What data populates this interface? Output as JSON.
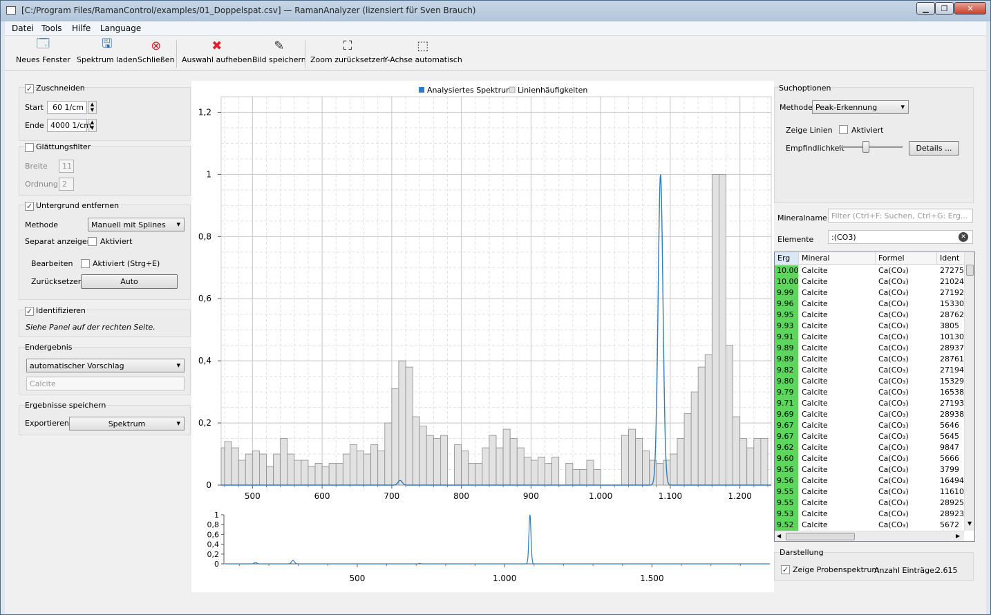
{
  "title": "[C:/Program Files/RamanControl/examples/01_Doppelspat.csv] — RamanAnalyzer (lizensiert für Sven Brauch)",
  "menu": [
    "Datei",
    "Tools",
    "Hilfe",
    "Language"
  ],
  "toolbar": [
    {
      "label": "Neues Fenster",
      "icon": "window-icon"
    },
    {
      "label": "Spektrum laden",
      "icon": "load-icon"
    },
    {
      "label": "Schließen",
      "icon": "close-doc-icon"
    },
    {
      "label": "Auswahl aufheben",
      "icon": "deselect-icon"
    },
    {
      "label": "Bild speichern",
      "icon": "save-image-icon"
    },
    {
      "label": "Zoom zurücksetzen",
      "icon": "zoom-reset-icon"
    },
    {
      "label": "Y-Achse automatisch",
      "icon": "y-auto-icon"
    }
  ],
  "left": {
    "crop": {
      "label": "Zuschneiden",
      "checked": true,
      "start_label": "Start",
      "start": "60 1/cm",
      "end_label": "Ende",
      "end": "4000 1/cm"
    },
    "smooth": {
      "label": "Glättungsfilter",
      "checked": false,
      "width_label": "Breite",
      "width": "11",
      "order_label": "Ordnung",
      "order": "2"
    },
    "background": {
      "label": "Untergrund entfernen",
      "checked": true,
      "method_label": "Methode",
      "method": "Manuell mit Splines",
      "separate_label": "Separat anzeigen",
      "separate_cb": "Aktiviert",
      "edit_label": "Bearbeiten",
      "edit_cb": "Aktiviert (Strg+E)",
      "reset_label": "Zurücksetzen",
      "reset_btn": "Auto"
    },
    "identify": {
      "label": "Identifizieren",
      "checked": true,
      "hint": "Siehe Panel auf der rechten Seite."
    },
    "result": {
      "label": "Endergebnis",
      "combo": "automatischer Vorschlag",
      "value": "Calcite"
    },
    "save": {
      "label": "Ergebnisse speichern",
      "export_label": "Exportieren",
      "export_combo": "Spektrum"
    }
  },
  "chart_data": [
    {
      "type": "area",
      "legend": [
        "Analysiertes Spektrum",
        "Linienhäufigkeiten"
      ],
      "legend_position": "top-center",
      "colors": {
        "spectrum": "#2e7bbf",
        "histogram": "#e2e2e2"
      },
      "xlim": [
        455,
        1245
      ],
      "ylim": [
        0,
        1.25
      ],
      "x_ticks": [
        "500",
        "600",
        "700",
        "800",
        "900",
        "1.000",
        "1.100",
        "1.200"
      ],
      "x_tick_values": [
        500,
        600,
        700,
        800,
        900,
        1000,
        1100,
        1200
      ],
      "y_ticks": [
        "0",
        "0,2",
        "0,4",
        "0,6",
        "0,8",
        "1",
        "1,2"
      ],
      "y_tick_values": [
        0,
        0.2,
        0.4,
        0.6,
        0.8,
        1,
        1.2
      ],
      "histogram": {
        "bin_start": 450,
        "bin_width": 10,
        "heights": [
          0.12,
          0.14,
          0.12,
          0.08,
          0.1,
          0.11,
          0.1,
          0.06,
          0.1,
          0.15,
          0.1,
          0.08,
          0.08,
          0.06,
          0.07,
          0.06,
          0.07,
          0.07,
          0.1,
          0.13,
          0.11,
          0.1,
          0.13,
          0.11,
          0.2,
          0.31,
          0.4,
          0.38,
          0.22,
          0.19,
          0.16,
          0.15,
          0.16,
          0.0,
          0.13,
          0.11,
          0.07,
          0.07,
          0.12,
          0.16,
          0.12,
          0.18,
          0.15,
          0.12,
          0.09,
          0.08,
          0.09,
          0.07,
          0.09,
          0.0,
          0.07,
          0.05,
          0.05,
          0.08,
          0.05,
          0.0,
          0.0,
          0.0,
          0.16,
          0.18,
          0.15,
          0.11,
          0.08,
          0.07,
          0.08,
          0.1,
          0.15,
          0.23,
          0.3,
          0.38,
          0.42,
          1.0,
          1.0,
          0.45,
          0.22,
          0.15,
          0.12,
          0.15,
          0.15,
          0.0,
          0.0,
          0.0,
          0.0,
          0.0,
          0.0,
          0.0,
          0.0,
          0.02,
          0.02,
          0.02,
          0.0,
          0.02,
          0.02
        ]
      },
      "spectrum": {
        "baseline": 0.0,
        "peaks": [
          {
            "x": 712,
            "y": 0.015,
            "w": 3
          },
          {
            "x": 1086,
            "y": 1.0,
            "w": 3.5
          }
        ]
      }
    },
    {
      "type": "line",
      "title": "",
      "xlim": [
        50,
        1900
      ],
      "ylim": [
        0,
        1
      ],
      "x_ticks": [
        "500",
        "1.000",
        "1.500"
      ],
      "x_tick_values": [
        500,
        1000,
        1500
      ],
      "y_ticks": [
        "0",
        "0,2",
        "0,4",
        "0,6",
        "0,8",
        "1"
      ],
      "y_tick_values": [
        0,
        0.2,
        0.4,
        0.6,
        0.8,
        1
      ],
      "peaks": [
        {
          "x": 155,
          "y": 0.03,
          "w": 4
        },
        {
          "x": 282,
          "y": 0.07,
          "w": 5
        },
        {
          "x": 712,
          "y": 0.01,
          "w": 3
        },
        {
          "x": 1086,
          "y": 1.0,
          "w": 3.5
        }
      ]
    }
  ],
  "right": {
    "search": {
      "label": "Suchoptionen",
      "method_label": "Methode",
      "method": "Peak-Erkennung",
      "show_lines_label": "Zeige Linien",
      "show_lines_cb": "Aktiviert",
      "sensitivity_label": "Empfindlichkeit",
      "sensitivity": 0.42,
      "details_btn": "Details ..."
    },
    "mineral_label": "Mineralname",
    "mineral_placeholder": "Filter (Ctrl+F: Suchen, Ctrl+G: Erg...",
    "elements_label": "Elemente",
    "elements_value": ":(CO3)",
    "columns": [
      "Erg",
      "Mineral",
      "Formel",
      "Ident"
    ],
    "rows": [
      [
        "10.00",
        "Calcite",
        "Ca(CO₃)",
        "27275"
      ],
      [
        "10.00",
        "Calcite",
        "Ca(CO₃)",
        "21024"
      ],
      [
        "9.99",
        "Calcite",
        "Ca(CO₃)",
        "27192"
      ],
      [
        "9.96",
        "Calcite",
        "Ca(CO₃)",
        "15330"
      ],
      [
        "9.95",
        "Calcite",
        "Ca(CO₃)",
        "28762"
      ],
      [
        "9.93",
        "Calcite",
        "Ca(CO₃)",
        "3805"
      ],
      [
        "9.91",
        "Calcite",
        "Ca(CO₃)",
        "10130"
      ],
      [
        "9.89",
        "Calcite",
        "Ca(CO₃)",
        "28937"
      ],
      [
        "9.89",
        "Calcite",
        "Ca(CO₃)",
        "28761"
      ],
      [
        "9.82",
        "Calcite",
        "Ca(CO₃)",
        "27194"
      ],
      [
        "9.80",
        "Calcite",
        "Ca(CO₃)",
        "15329"
      ],
      [
        "9.79",
        "Calcite",
        "Ca(CO₃)",
        "16538"
      ],
      [
        "9.71",
        "Calcite",
        "Ca(CO₃)",
        "27193"
      ],
      [
        "9.69",
        "Calcite",
        "Ca(CO₃)",
        "28938"
      ],
      [
        "9.67",
        "Calcite",
        "Ca(CO₃)",
        "5646"
      ],
      [
        "9.67",
        "Calcite",
        "Ca(CO₃)",
        "5645"
      ],
      [
        "9.62",
        "Calcite",
        "Ca(CO₃)",
        "9847"
      ],
      [
        "9.60",
        "Calcite",
        "Ca(CO₃)",
        "5666"
      ],
      [
        "9.56",
        "Calcite",
        "Ca(CO₃)",
        "3799"
      ],
      [
        "9.56",
        "Calcite",
        "Ca(CO₃)",
        "16494"
      ],
      [
        "9.55",
        "Calcite",
        "Ca(CO₃)",
        "11610"
      ],
      [
        "9.55",
        "Calcite",
        "Ca(CO₃)",
        "28925"
      ],
      [
        "9.53",
        "Calcite",
        "Ca(CO₃)",
        "28923"
      ],
      [
        "9.52",
        "Calcite",
        "Ca(CO₃)",
        "5672"
      ]
    ],
    "display": {
      "label": "Darstellung",
      "show_sample_cb": "Zeige Probenspektrum",
      "count_label": "Anzahl Einträge:",
      "count": "2.615"
    }
  }
}
